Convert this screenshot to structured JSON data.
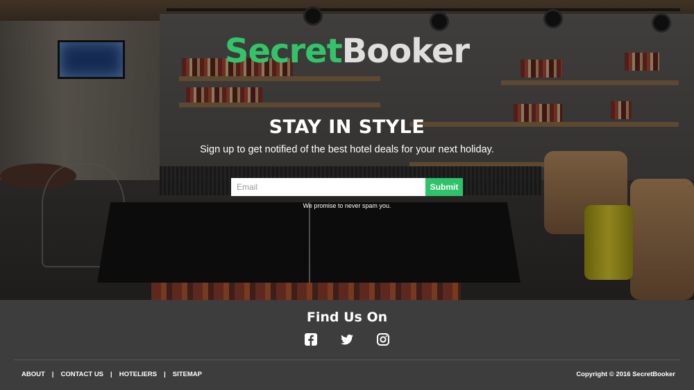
{
  "hero": {
    "logo_part1": "Secret",
    "logo_part2": "Booker",
    "headline": "STAY IN STYLE",
    "subline": "Sign up to get notified of the best hotel deals for your next holiday.",
    "email_placeholder": "Email",
    "submit_label": "Submit",
    "spam_note": "We promise to never spam you.",
    "brand_green": "#33c46a"
  },
  "footer": {
    "find_us": "Find Us On",
    "socials": [
      "facebook-icon",
      "twitter-icon",
      "instagram-icon"
    ],
    "links": [
      "ABOUT",
      "CONTACT US",
      "HOTELIERS",
      "SITEMAP"
    ],
    "separator": "|",
    "copyright": "Copyright © 2016 SecretBooker",
    "background": "#3d3d3d"
  }
}
